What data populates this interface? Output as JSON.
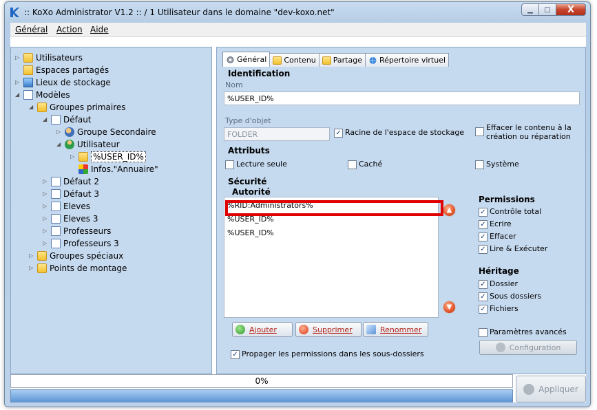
{
  "window": {
    "title": ":: KoXo Administrator V1.2 :: / 1 Utilisateur dans le domaine \"dev-koxo.net\"",
    "minimize_glyph": "▁",
    "maximize_glyph": "□",
    "close_glyph": "X"
  },
  "menu": [
    {
      "label": "Général",
      "underline": "G"
    },
    {
      "label": "Action",
      "underline": "A"
    },
    {
      "label": "Aide",
      "underline": "A"
    }
  ],
  "tree": [
    {
      "label": "Utilisateurs",
      "icon": "folder-icon",
      "depth": 0,
      "expander": "▷"
    },
    {
      "label": "Espaces partagés",
      "icon": "shared-folder-icon",
      "depth": 0,
      "expander": ""
    },
    {
      "label": "Lieux de stockage",
      "icon": "storage-icon",
      "depth": 0,
      "expander": "▷"
    },
    {
      "label": "Modèles",
      "icon": "models-icon",
      "depth": 0,
      "expander": "◢"
    },
    {
      "label": "Groupes primaires",
      "icon": "folder-icon",
      "depth": 1,
      "expander": "◢"
    },
    {
      "label": "Défaut",
      "icon": "document-icon",
      "depth": 2,
      "expander": "◢"
    },
    {
      "label": "Groupe Secondaire",
      "icon": "group-icon",
      "depth": 3,
      "expander": "▷"
    },
    {
      "label": "Utilisateur",
      "icon": "user-icon",
      "depth": 3,
      "expander": "◢"
    },
    {
      "label": "%USER_ID%",
      "icon": "folder-icon",
      "depth": 4,
      "expander": "▷",
      "selected": true
    },
    {
      "label": "Infos.\"Annuaire\"",
      "icon": "shortcut-icon",
      "depth": 4,
      "expander": ""
    },
    {
      "label": "Défaut 2",
      "icon": "document-icon",
      "depth": 2,
      "expander": "▷"
    },
    {
      "label": "Défaut 3",
      "icon": "document-icon",
      "depth": 2,
      "expander": "▷"
    },
    {
      "label": "Eleves",
      "icon": "document-icon",
      "depth": 2,
      "expander": "▷"
    },
    {
      "label": "Eleves 3",
      "icon": "document-icon",
      "depth": 2,
      "expander": "▷"
    },
    {
      "label": "Professeurs",
      "icon": "document-icon",
      "depth": 2,
      "expander": "▷"
    },
    {
      "label": "Professeurs 3",
      "icon": "document-icon",
      "depth": 2,
      "expander": "▷"
    },
    {
      "label": "Groupes spéciaux",
      "icon": "folder-icon",
      "depth": 1,
      "expander": "▷"
    },
    {
      "label": "Points de montage",
      "icon": "folder-icon",
      "depth": 1,
      "expander": "▷"
    }
  ],
  "tabs": [
    {
      "label": "Général",
      "icon": "gear-icon",
      "active": true
    },
    {
      "label": "Contenu",
      "icon": "folder-icon",
      "active": false
    },
    {
      "label": "Partage",
      "icon": "shared-folder-icon",
      "active": false
    },
    {
      "label": "Répertoire virtuel",
      "icon": "globe-icon",
      "active": false
    }
  ],
  "identification": {
    "title": "Identification",
    "nom_label": "Nom",
    "nom_value": "%USER_ID%",
    "type_label": "Type d'objet",
    "type_value": "FOLDER",
    "racine_label": "Racine de l'espace de stockage",
    "racine_checked": true,
    "effacer_label_1": "Effacer le contenu à la",
    "effacer_label_2": "création ou réparation",
    "effacer_checked": false
  },
  "attributs": {
    "title": "Attributs",
    "lecture_label": "Lecture seule",
    "lecture_checked": false,
    "cache_label": "Caché",
    "cache_checked": false,
    "systeme_label": "Système",
    "systeme_checked": false
  },
  "securite": {
    "title": "Sécurité",
    "autorite_label": "Autorité",
    "entries": [
      "%RID:Administrators%",
      "%USER_ID%",
      "%USER_ID%"
    ],
    "up_glyph": "▲",
    "down_glyph": "▼"
  },
  "permissions": {
    "title": "Permissions",
    "items": [
      {
        "label": "Contrôle total",
        "checked": true
      },
      {
        "label": "Ecrire",
        "checked": true
      },
      {
        "label": "Effacer",
        "checked": true
      },
      {
        "label": "Lire & Exécuter",
        "checked": true
      }
    ]
  },
  "heritage": {
    "title": "Héritage",
    "items": [
      {
        "label": "Dossier",
        "checked": true
      },
      {
        "label": "Sous dossiers",
        "checked": true
      },
      {
        "label": "Fichiers",
        "checked": true
      }
    ]
  },
  "buttons": {
    "ajouter": "Ajouter",
    "supprimer": "Supprimer",
    "renommer": "Renommer",
    "configuration": "Configuration",
    "appliquer": "Appliquer"
  },
  "parametres_avances": {
    "label": "Paramètres avancés",
    "checked": false
  },
  "propager": {
    "label": "Propager les permissions dans les sous-dossiers",
    "checked": true
  },
  "progress": {
    "text": "0%",
    "value": 0
  },
  "check_glyph": "✓"
}
